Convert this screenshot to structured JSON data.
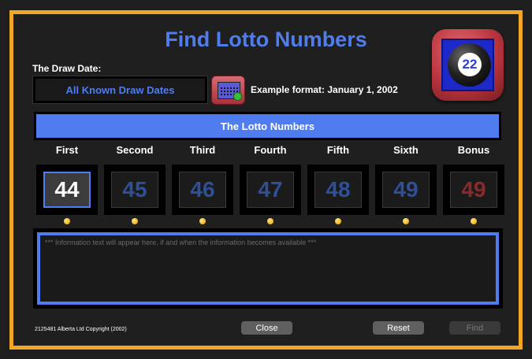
{
  "window": {
    "title": "Find Lotto Numbers"
  },
  "draw_date": {
    "label": "The Draw Date:",
    "value": "All Known Draw Dates",
    "example": "Example format: January 1, 2002",
    "calendar_icon": "calendar-icon"
  },
  "numbers_header": "The Lotto Numbers",
  "app_icon": {
    "number": "22",
    "icon": "lotto-ball-icon"
  },
  "columns": [
    {
      "label": "First",
      "value": "44"
    },
    {
      "label": "Second",
      "value": "45"
    },
    {
      "label": "Third",
      "value": "46"
    },
    {
      "label": "Fourth",
      "value": "47"
    },
    {
      "label": "Fifth",
      "value": "48"
    },
    {
      "label": "Sixth",
      "value": "49"
    },
    {
      "label": "Bonus",
      "value": "49"
    }
  ],
  "info_placeholder": "*** Information text will appear here, if and when the information becomes available ***",
  "footer": {
    "copyright": "2125481 Alberta Ltd Copyright (2002)",
    "close_label": "Close",
    "reset_label": "Reset",
    "find_label": "Find"
  },
  "colors": {
    "accent": "#4f7df0",
    "frame": "#f2a626",
    "bonus": "#8a2a2a"
  }
}
